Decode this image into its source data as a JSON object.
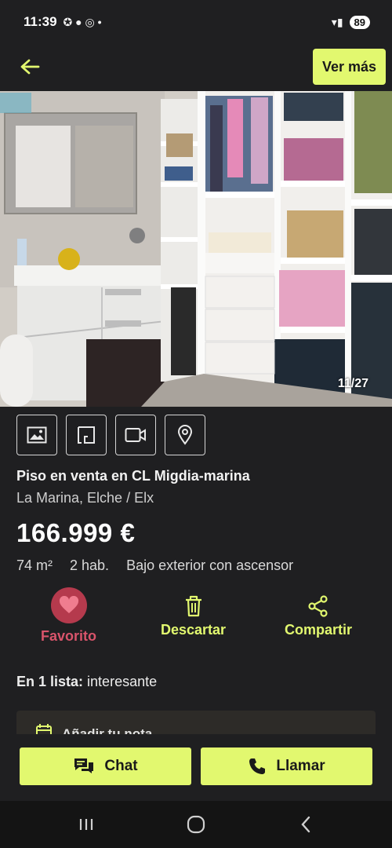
{
  "status_bar": {
    "time": "11:39",
    "battery": "89"
  },
  "top_bar": {
    "ver_mas_label": "Ver más"
  },
  "gallery": {
    "counter": "11/27"
  },
  "media_buttons": [
    "photos-icon",
    "floorplan-icon",
    "video-icon",
    "location-pin-icon"
  ],
  "listing": {
    "title": "Piso en venta en CL Migdia-marina",
    "location": "La Marina, Elche / Elx",
    "price": "166.999 €",
    "area": "74 m²",
    "rooms": "2 hab.",
    "floor": "Bajo exterior con ascensor"
  },
  "actions": {
    "favorite": "Favorito",
    "discard": "Descartar",
    "share": "Compartir"
  },
  "lists": {
    "prefix": "En 1 lista:",
    "value": "interesante"
  },
  "note": {
    "label": "Añadir tu nota"
  },
  "cta": {
    "chat": "Chat",
    "call": "Llamar"
  },
  "colors": {
    "accent": "#e2f86f",
    "favorite": "#b53a4d",
    "background": "#1f1f21"
  }
}
